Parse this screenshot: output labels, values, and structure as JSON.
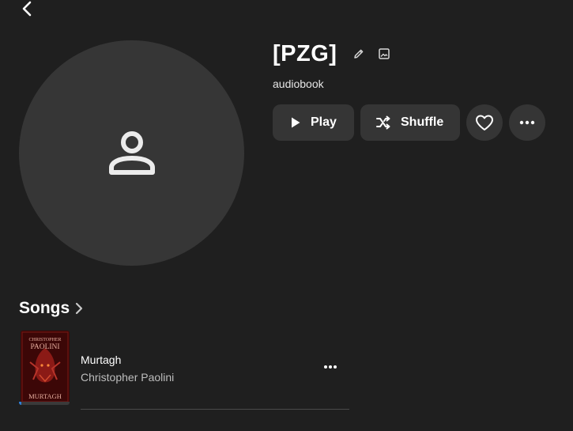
{
  "nav": {
    "back_icon": "chevron-left-icon"
  },
  "artist": {
    "name": "[PZG]",
    "subtitle": "audiobook",
    "avatar_icon": "person-icon",
    "edit_icon": "pencil-icon",
    "image_icon": "image-icon"
  },
  "actions": {
    "play_label": "Play",
    "play_icon": "play-icon",
    "shuffle_label": "Shuffle",
    "shuffle_icon": "shuffle-icon",
    "favorite_icon": "heart-icon",
    "more_icon": "more-horizontal-icon"
  },
  "songs_section": {
    "title": "Songs",
    "chevron_icon": "chevron-right-icon",
    "items": [
      {
        "title": "Murtagh",
        "artist": "Christopher Paolini",
        "cover_lines": [
          "CHRISTOPHER",
          "PAOLINI",
          "MURTAGH"
        ],
        "progress": 0.05,
        "more_icon": "more-horizontal-icon"
      }
    ]
  },
  "colors": {
    "background": "#1f1f1f",
    "surface": "#353535",
    "avatar_bg": "#363636",
    "text_primary": "#ffffff",
    "text_secondary": "#bdbdbd",
    "progress": "#2f7fd8",
    "cover_red": "#8b1a16"
  }
}
